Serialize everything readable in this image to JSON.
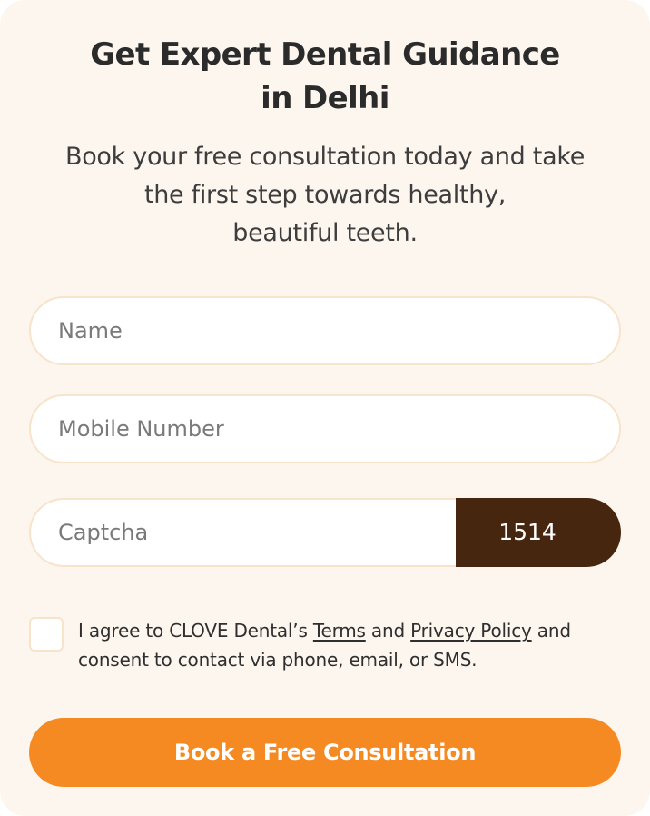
{
  "form": {
    "title_line1": "Get Expert Dental Guidance",
    "title_line2": "in Delhi",
    "subtitle_line1": "Book your free consultation today and take",
    "subtitle_line2": "the first step towards healthy,",
    "subtitle_line3": "beautiful teeth.",
    "name_placeholder": "Name",
    "mobile_placeholder": "Mobile Number",
    "captcha_placeholder": "Captcha",
    "captcha_code": "1514",
    "consent_prefix": "I agree to CLOVE Dental’s",
    "terms_link": "Terms",
    "consent_and": "and",
    "privacy_link": "Privacy Policy",
    "consent_suffix": "and consent to contact via phone, email, or SMS.",
    "checkbox_checked": false,
    "submit_label": "Book a Free Consultation"
  },
  "colors": {
    "card_background": "#fdf6ef",
    "field_border": "#f8e3cb",
    "captcha_background": "#472610",
    "button_background": "#f58a23",
    "text_dark": "#2b2b2b"
  }
}
